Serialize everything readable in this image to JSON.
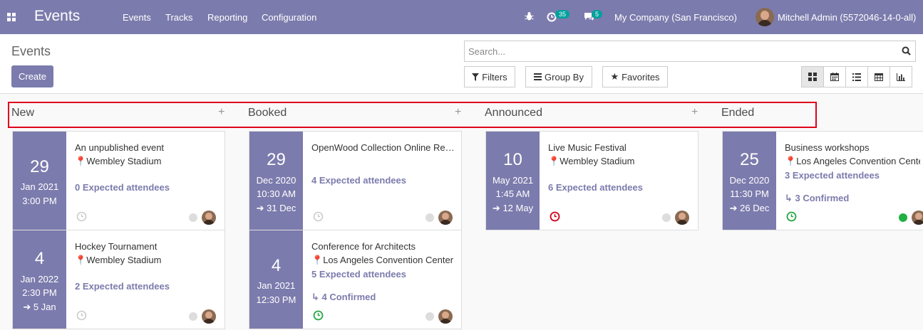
{
  "navbar": {
    "app_title": "Events",
    "menu": [
      "Events",
      "Tracks",
      "Reporting",
      "Configuration"
    ],
    "activity_count": "35",
    "message_count": "5",
    "company": "My Company (San Francisco)",
    "user": "Mitchell Admin (5572046-14-0-all)"
  },
  "control": {
    "title": "Events",
    "create_label": "Create",
    "search_placeholder": "Search...",
    "filters_label": "Filters",
    "groupby_label": "Group By",
    "favorites_label": "Favorites"
  },
  "columns": [
    {
      "name": "New",
      "cards": [
        {
          "day": "29",
          "month_year": "Jan 2021",
          "time": "3:00 PM",
          "end": "",
          "title": "An unpublished event",
          "location": "Wembley Stadium",
          "attendees": "0 Expected attendees",
          "confirmed": "",
          "clock": "grey",
          "state": "grey"
        },
        {
          "day": "4",
          "month_year": "Jan 2022",
          "time": "2:30 PM",
          "end": "5 Jan",
          "title": "Hockey Tournament",
          "location": "Wembley Stadium",
          "attendees": "2 Expected attendees",
          "confirmed": "",
          "clock": "grey",
          "state": "grey"
        }
      ]
    },
    {
      "name": "Booked",
      "cards": [
        {
          "day": "29",
          "month_year": "Dec 2020",
          "time": "10:30 AM",
          "end": "31 Dec",
          "title": "OpenWood Collection Online Reveal",
          "location": "",
          "attendees": "4 Expected attendees",
          "confirmed": "",
          "clock": "grey",
          "state": "grey"
        },
        {
          "day": "4",
          "month_year": "Jan 2021",
          "time": "12:30 PM",
          "end": "",
          "title": "Conference for Architects",
          "location": "Los Angeles Convention Center",
          "attendees": "5 Expected attendees",
          "confirmed": "4 Confirmed",
          "clock": "green",
          "state": "grey"
        }
      ]
    },
    {
      "name": "Announced",
      "cards": [
        {
          "day": "10",
          "month_year": "May 2021",
          "time": "1:45 AM",
          "end": "12 May",
          "title": "Live Music Festival",
          "location": "Wembley Stadium",
          "attendees": "6 Expected attendees",
          "confirmed": "",
          "clock": "red",
          "state": "grey"
        }
      ]
    },
    {
      "name": "Ended",
      "cards": [
        {
          "day": "25",
          "month_year": "Dec 2020",
          "time": "11:30 PM",
          "end": "26 Dec",
          "title": "Business workshops",
          "location": "Los Angeles Convention Center",
          "attendees": "3 Expected attendees",
          "confirmed": "3 Confirmed",
          "clock": "green",
          "state": "green"
        }
      ]
    }
  ],
  "colors": {
    "brand": "#7c7bad",
    "clock_grey": "#cccccc",
    "clock_red": "#d0021b",
    "clock_green": "#28a745",
    "state_green": "#21b042"
  }
}
